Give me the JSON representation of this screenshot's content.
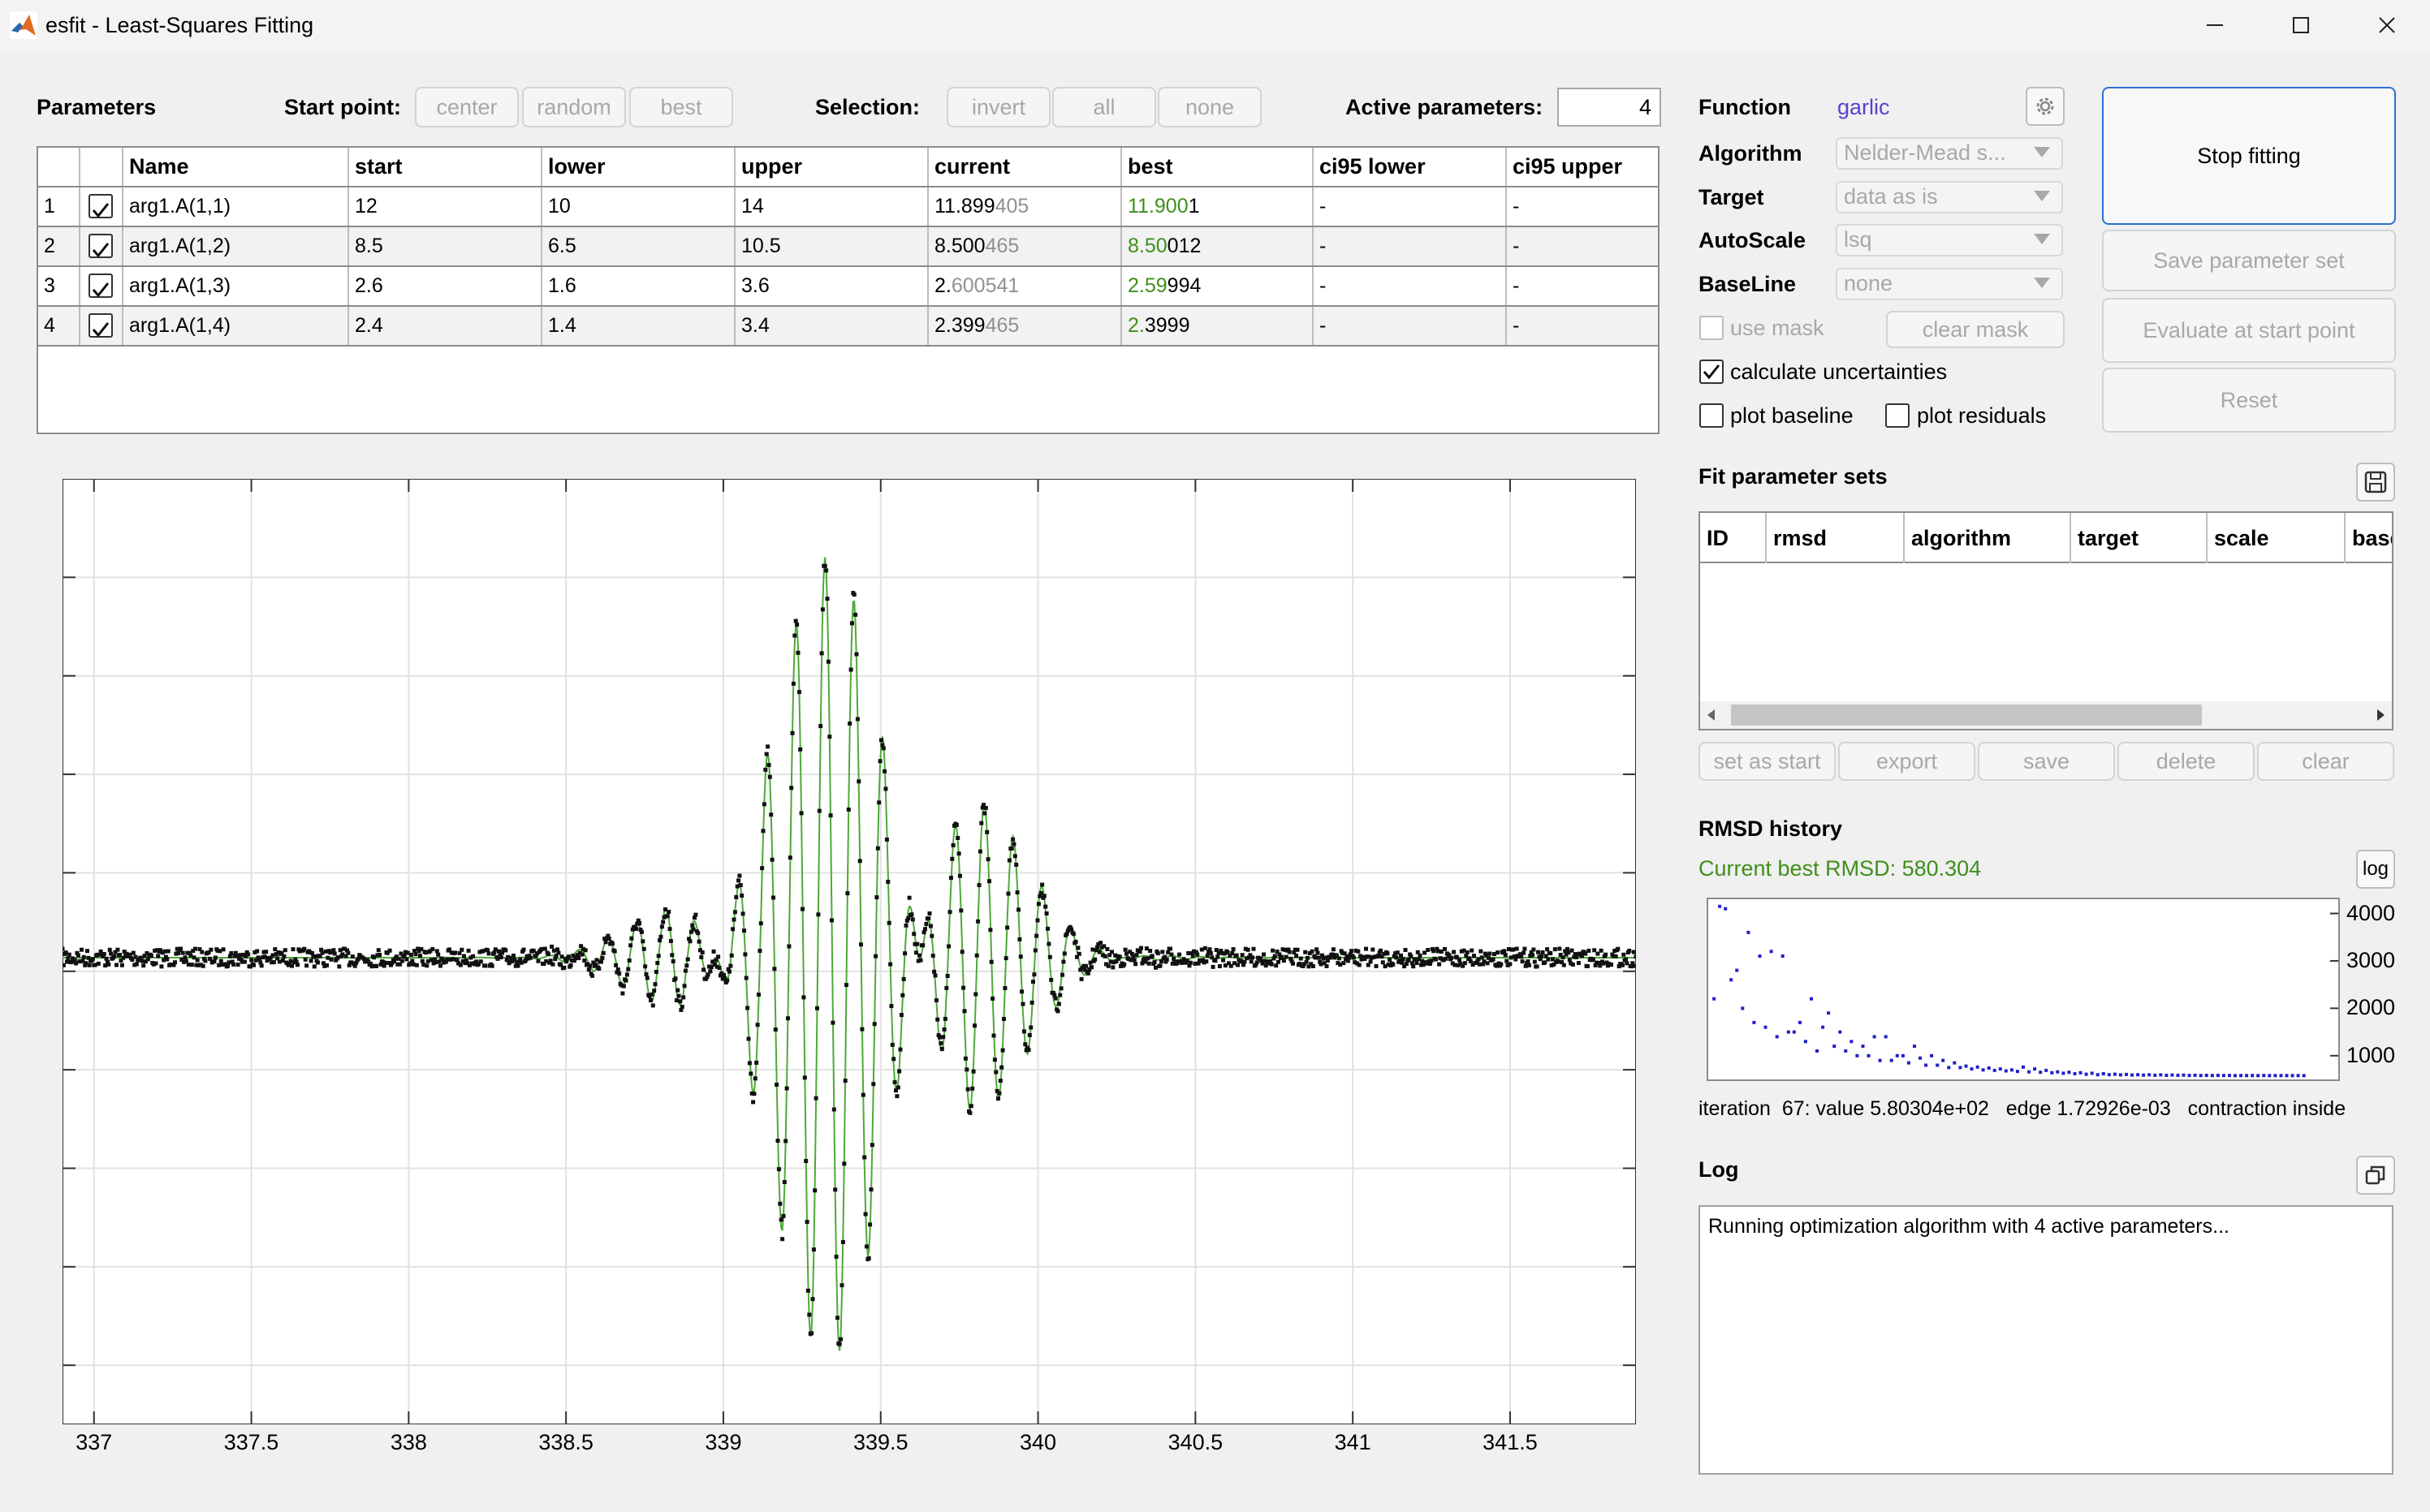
{
  "window": {
    "title": "esfit - Least-Squares Fitting",
    "minimize_icon": "minimize-icon",
    "maximize_icon": "maximize-icon",
    "close_icon": "close-icon"
  },
  "parameters": {
    "heading": "Parameters",
    "start_point_label": "Start point:",
    "start_buttons": [
      "center",
      "random",
      "best"
    ],
    "selection_label": "Selection:",
    "selection_buttons": [
      "invert",
      "all",
      "none"
    ],
    "active_label": "Active parameters:",
    "active_value": "4",
    "columns": [
      "",
      "",
      "Name",
      "start",
      "lower",
      "upper",
      "current",
      "best",
      "ci95 lower",
      "ci95 upper"
    ],
    "rows": [
      {
        "idx": "1",
        "checked": true,
        "name": "arg1.A(1,1)",
        "start": "12",
        "lower": "10",
        "upper": "14",
        "current_main": "11.899",
        "current_dim": "405",
        "best_green": "11.900",
        "best_rest": "1",
        "ci_lower": "-",
        "ci_upper": "-"
      },
      {
        "idx": "2",
        "checked": true,
        "name": "arg1.A(1,2)",
        "start": "8.5",
        "lower": "6.5",
        "upper": "10.5",
        "current_main": "8.500",
        "current_dim": "465",
        "best_green": "8.50",
        "best_rest": "012",
        "ci_lower": "-",
        "ci_upper": "-"
      },
      {
        "idx": "3",
        "checked": true,
        "name": "arg1.A(1,3)",
        "start": "2.6",
        "lower": "1.6",
        "upper": "3.6",
        "current_main": "2.",
        "current_dim": "600541",
        "best_green": "2.59",
        "best_rest": "994",
        "ci_lower": "-",
        "ci_upper": "-"
      },
      {
        "idx": "4",
        "checked": true,
        "name": "arg1.A(1,4)",
        "start": "2.4",
        "lower": "1.4",
        "upper": "3.4",
        "current_main": "2.399",
        "current_dim": "465",
        "best_green": "2.",
        "best_rest": "3999",
        "ci_lower": "-",
        "ci_upper": "-"
      }
    ]
  },
  "settings": {
    "function_label": "Function",
    "function_value": "garlic",
    "gear_icon": "gear-icon",
    "algorithm_label": "Algorithm",
    "algorithm_value": "Nelder-Mead s...",
    "target_label": "Target",
    "target_value": "data as is",
    "autoscale_label": "AutoScale",
    "autoscale_value": "lsq",
    "baseline_label": "BaseLine",
    "baseline_value": "none",
    "use_mask_label": "use mask",
    "clear_mask_label": "clear mask",
    "calc_unc_label": "calculate uncertainties",
    "plot_baseline_label": "plot baseline",
    "plot_residuals_label": "plot residuals"
  },
  "actions": {
    "stop_fitting": "Stop fitting",
    "save_parameter_set": "Save parameter set",
    "evaluate_start": "Evaluate at start point",
    "reset": "Reset"
  },
  "fit_sets": {
    "heading": "Fit parameter sets",
    "save_icon": "save-icon",
    "columns": [
      "ID",
      "rmsd",
      "algorithm",
      "target",
      "scale",
      "base"
    ],
    "buttons": [
      "set as start",
      "export",
      "save",
      "delete",
      "clear"
    ]
  },
  "rmsd": {
    "heading": "RMSD history",
    "current_best": "Current best RMSD: 580.304",
    "log_button": "log",
    "status": "iteration  67: value 5.80304e+02   edge 1.72926e-03   contraction inside",
    "yticks": [
      "4000",
      "3000",
      "2000",
      "1000"
    ]
  },
  "log": {
    "heading": "Log",
    "copy_icon": "copy-icon",
    "text": "Running optimization algorithm with 4 active parameters..."
  },
  "colors": {
    "accent_blue": "#2d6fd2",
    "function_purple": "#5b3fcf",
    "green": "#3e8f1a",
    "fit_line": "#4fa83a",
    "rmsd_point": "#2020c8"
  },
  "chart_data": [
    {
      "type": "scatter",
      "xlim": [
        336.9,
        341.9
      ],
      "xticks": [
        "337",
        "337.5",
        "338",
        "338.5",
        "339",
        "339.5",
        "340",
        "340.5",
        "341",
        "341.5"
      ],
      "xtick_values": [
        337,
        337.5,
        338,
        338.5,
        339,
        339.5,
        340,
        340.5,
        341,
        341.5
      ],
      "series": [
        {
          "style": "black-points"
        },
        {
          "style": "green-line"
        }
      ],
      "grid": true
    },
    {
      "type": "scatter",
      "yscale": "linear",
      "ylim": [
        500,
        4300
      ],
      "xlim": [
        0,
        110
      ],
      "values": [
        [
          1,
          2200
        ],
        [
          2,
          4150
        ],
        [
          3,
          4100
        ],
        [
          4,
          2600
        ],
        [
          5,
          2800
        ],
        [
          6,
          2000
        ],
        [
          7,
          3600
        ],
        [
          8,
          1700
        ],
        [
          9,
          3100
        ],
        [
          10,
          1600
        ],
        [
          11,
          3200
        ],
        [
          12,
          1400
        ],
        [
          13,
          3100
        ],
        [
          14,
          1500
        ],
        [
          15,
          1500
        ],
        [
          16,
          1700
        ],
        [
          17,
          1300
        ],
        [
          18,
          2200
        ],
        [
          19,
          1100
        ],
        [
          20,
          1600
        ],
        [
          21,
          1900
        ],
        [
          22,
          1200
        ],
        [
          23,
          1500
        ],
        [
          24,
          1100
        ],
        [
          25,
          1300
        ],
        [
          26,
          1000
        ],
        [
          27,
          1200
        ],
        [
          28,
          1000
        ],
        [
          29,
          1400
        ],
        [
          30,
          900
        ],
        [
          31,
          1400
        ],
        [
          32,
          900
        ],
        [
          33,
          1000
        ],
        [
          34,
          1000
        ],
        [
          35,
          850
        ],
        [
          36,
          1200
        ],
        [
          37,
          950
        ],
        [
          38,
          800
        ],
        [
          39,
          1000
        ],
        [
          40,
          800
        ],
        [
          41,
          900
        ],
        [
          42,
          750
        ],
        [
          43,
          850
        ],
        [
          44,
          750
        ],
        [
          45,
          780
        ],
        [
          46,
          720
        ],
        [
          47,
          760
        ],
        [
          48,
          700
        ],
        [
          49,
          740
        ],
        [
          50,
          690
        ],
        [
          51,
          720
        ],
        [
          52,
          680
        ],
        [
          53,
          700
        ],
        [
          54,
          670
        ],
        [
          55,
          760
        ],
        [
          56,
          660
        ],
        [
          57,
          720
        ],
        [
          58,
          650
        ],
        [
          59,
          690
        ],
        [
          60,
          640
        ],
        [
          61,
          660
        ],
        [
          62,
          630
        ],
        [
          63,
          650
        ],
        [
          64,
          620
        ],
        [
          65,
          640
        ],
        [
          66,
          610
        ],
        [
          67,
          630
        ],
        [
          68,
          600
        ],
        [
          69,
          620
        ],
        [
          70,
          600
        ],
        [
          71,
          610
        ],
        [
          72,
          595
        ],
        [
          73,
          605
        ],
        [
          74,
          592
        ],
        [
          75,
          600
        ],
        [
          76,
          590
        ],
        [
          77,
          598
        ],
        [
          78,
          588
        ],
        [
          79,
          595
        ],
        [
          80,
          586
        ],
        [
          81,
          592
        ],
        [
          82,
          585
        ],
        [
          83,
          590
        ],
        [
          84,
          584
        ],
        [
          85,
          588
        ],
        [
          86,
          583
        ],
        [
          87,
          586
        ],
        [
          88,
          582
        ],
        [
          89,
          585
        ],
        [
          90,
          582
        ],
        [
          91,
          584
        ],
        [
          92,
          581
        ],
        [
          93,
          583
        ],
        [
          94,
          581
        ],
        [
          95,
          582
        ],
        [
          96,
          580
        ],
        [
          97,
          582
        ],
        [
          98,
          580
        ],
        [
          99,
          581
        ],
        [
          100,
          580
        ],
        [
          101,
          581
        ],
        [
          102,
          580
        ],
        [
          103,
          580
        ],
        [
          104,
          580
        ]
      ]
    }
  ]
}
